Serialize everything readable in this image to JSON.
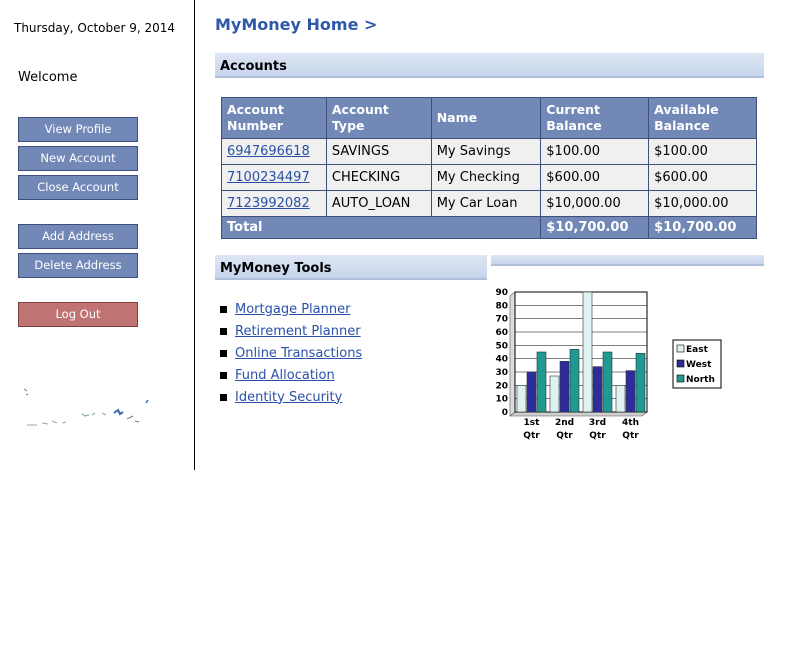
{
  "sidebar": {
    "date": "Thursday, October 9, 2014",
    "welcome": "Welcome",
    "buttons": {
      "view_profile": "View Profile",
      "new_account": "New Account",
      "close_account": "Close Account",
      "add_address": "Add Address",
      "delete_address": "Delete Address",
      "log_out": "Log Out"
    }
  },
  "header": {
    "breadcrumb": "MyMoney Home >"
  },
  "accounts": {
    "title": "Accounts",
    "columns": {
      "number": [
        "Account",
        "Number"
      ],
      "type": [
        "Account",
        "Type"
      ],
      "name": "Name",
      "current": [
        "Current",
        "Balance"
      ],
      "available": [
        "Available",
        "Balance"
      ]
    },
    "rows": [
      {
        "number": "6947696618",
        "type": "SAVINGS",
        "name": "My Savings",
        "current": "$100.00",
        "available": "$100.00"
      },
      {
        "number": "7100234497",
        "type": "CHECKING",
        "name": "My Checking",
        "current": "$600.00",
        "available": "$600.00"
      },
      {
        "number": "7123992082",
        "type": "AUTO_LOAN",
        "name": "My Car Loan",
        "current": "$10,000.00",
        "available": "$10,000.00"
      }
    ],
    "total": {
      "label": "Total",
      "current": "$10,700.00",
      "available": "$10,700.00"
    }
  },
  "tools": {
    "title": "MyMoney Tools",
    "items": [
      "Mortgage Planner",
      "Retirement Planner",
      "Online Transactions",
      "Fund Allocation",
      "Identity Security"
    ]
  },
  "colors": {
    "accent": "#7289b8",
    "logout": "#bf7473",
    "link": "#2a50a8",
    "east": "#dff1f1",
    "west": "#2e2b9c",
    "north": "#1f9a93"
  },
  "chart_data": {
    "type": "bar",
    "title": "",
    "xlabel": "",
    "ylabel": "",
    "categories": [
      [
        "1st",
        "Qtr"
      ],
      [
        "2nd",
        "Qtr"
      ],
      [
        "3rd",
        "Qtr"
      ],
      [
        "4th",
        "Qtr"
      ]
    ],
    "series": [
      {
        "name": "East",
        "values": [
          20,
          27,
          90,
          20
        ]
      },
      {
        "name": "West",
        "values": [
          30,
          38,
          34,
          31
        ]
      },
      {
        "name": "North",
        "values": [
          45,
          47,
          45,
          44
        ]
      }
    ],
    "ylim": [
      0,
      90
    ],
    "yticks": [
      0,
      10,
      20,
      30,
      40,
      50,
      60,
      70,
      80,
      90
    ],
    "grid": true,
    "legend": "right"
  }
}
